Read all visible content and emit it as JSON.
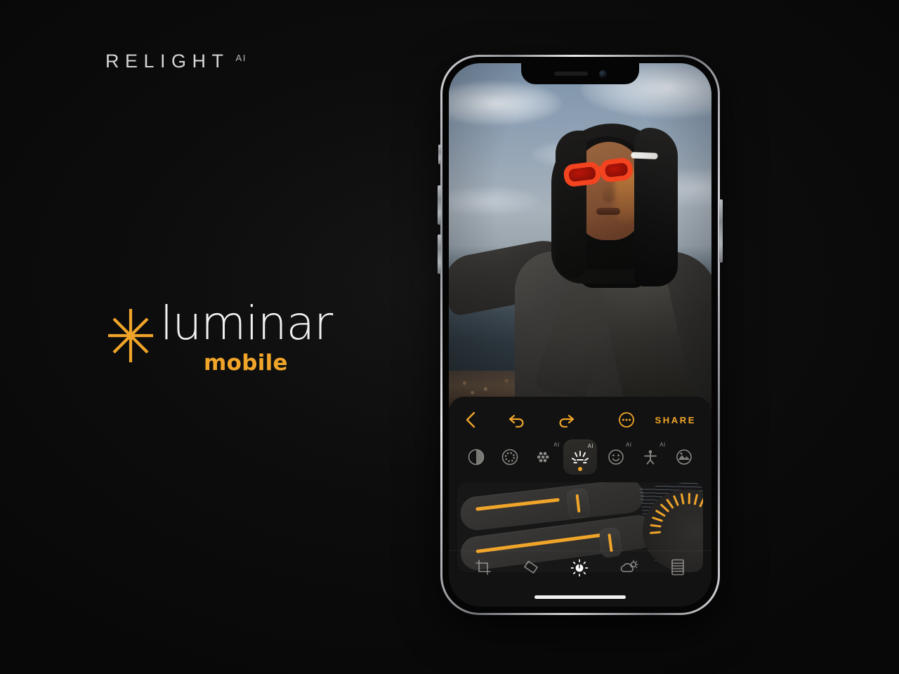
{
  "branding": {
    "relight_word": "RELIGHT",
    "relight_superscript": "AI",
    "product_name": "luminar",
    "product_sub": "mobile",
    "accent_color": "#f0a52a",
    "star_icon": "asterisk-star-icon"
  },
  "phone": {
    "device": "iphone-12-pro",
    "frame_color": "#c9cbcf",
    "buttons": [
      "silent-switch",
      "volume-up",
      "volume-down",
      "power"
    ]
  },
  "photo": {
    "description": "portrait-of-person-in-black-hood-and-grey-wool-coat-with-red-sunglasses-at-seaside"
  },
  "editor": {
    "toolbar": {
      "back_icon": "chevron-left-icon",
      "undo_icon": "undo-arrow-icon",
      "redo_icon": "redo-arrow-icon",
      "more_icon": "more-dots-circle-icon",
      "share_label": "SHARE"
    },
    "tools": [
      {
        "name": "contrast",
        "icon": "contrast-half-circle-icon",
        "ai": false,
        "selected": false
      },
      {
        "name": "structure",
        "icon": "dotted-ring-circle-icon",
        "ai": false,
        "selected": false
      },
      {
        "name": "grain",
        "icon": "seven-dots-grain-icon",
        "ai": "AI",
        "selected": false
      },
      {
        "name": "relight",
        "icon": "relight-rays-icon",
        "ai": "AI",
        "selected": true
      },
      {
        "name": "face",
        "icon": "smiley-face-circle-icon",
        "ai": "AI",
        "selected": false
      },
      {
        "name": "body",
        "icon": "person-body-icon",
        "ai": "AI",
        "selected": false
      },
      {
        "name": "landscape",
        "icon": "mountain-circle-icon",
        "ai": false,
        "selected": false
      }
    ],
    "sliders": [
      {
        "name": "slider-upper",
        "fill_percent": 42,
        "accent": "#f0a52a"
      },
      {
        "name": "slider-lower",
        "fill_percent": 64,
        "accent": "#f0a52a"
      }
    ],
    "dial": {
      "name": "radial-dial",
      "ticks": 14,
      "accent": "#f0a52a"
    },
    "bottom_tabs": [
      {
        "name": "crop",
        "icon": "crop-icon",
        "active": false
      },
      {
        "name": "erase",
        "icon": "eraser-icon",
        "active": false
      },
      {
        "name": "light",
        "icon": "sun-light-icon",
        "active": true
      },
      {
        "name": "sky",
        "icon": "cloud-sun-icon",
        "active": false
      },
      {
        "name": "film",
        "icon": "film-strip-icon",
        "active": false
      }
    ],
    "home_indicator": "home-indicator-bar"
  }
}
